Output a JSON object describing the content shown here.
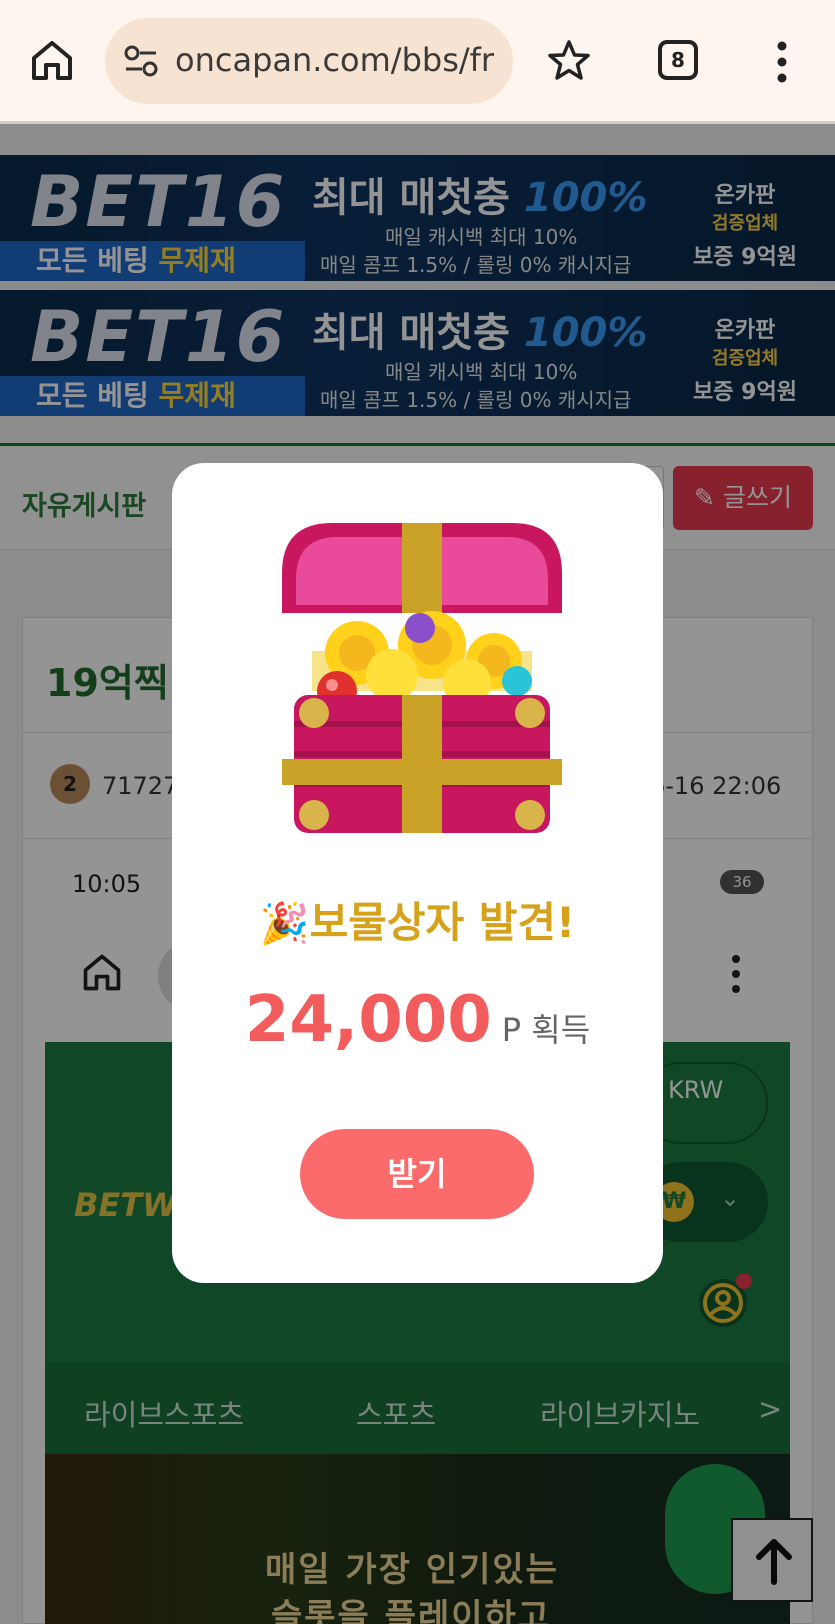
{
  "browser": {
    "url": "oncapan.com/bbs/fr",
    "tab_count": "8"
  },
  "banners": [
    {
      "brand": "BET16",
      "tagline_prefix": "모든 베팅 ",
      "tagline_highlight": "무제재",
      "headline_prefix": "최대 매첫충 ",
      "headline_highlight": "100%",
      "sub1": "매일 캐시백 최대 10%",
      "sub2": "매일 콤프 1.5% / 롤링 0% 캐시지급",
      "badge_line1": "온카판",
      "badge_line2": "검증업체",
      "badge_line3": "보증 9억원"
    },
    {
      "brand": "BET16",
      "tagline_prefix": "모든 베팅 ",
      "tagline_highlight": "무제재",
      "headline_prefix": "최대 매첫충 ",
      "headline_highlight": "100%",
      "sub1": "매일 캐시백 최대 10%",
      "sub2": "매일 콤프 1.5% / 롤링 0% 캐시지급",
      "badge_line1": "온카판",
      "badge_line2": "검증업체",
      "badge_line3": "보증 9억원"
    }
  ],
  "board": {
    "title": "자유게시판",
    "write_button": "글쓰기"
  },
  "post": {
    "title": "19억찍",
    "author_level": "2",
    "author": "71727",
    "date": "6-16 22:06"
  },
  "embedded": {
    "time": "10:05",
    "status_badge": "36",
    "currency": "KRW",
    "site_logo": "BETW",
    "coin_symbol": "₩",
    "nav": [
      "라이브스포츠",
      "스포츠",
      "라이브카지노",
      ">"
    ],
    "promo_line1": "매일 가장 인기있는",
    "promo_line2": "슬롯을 플레이하고"
  },
  "modal": {
    "emoji": "🎉",
    "title": "보물상자 발견!",
    "points": "24,000",
    "points_unit": "P 획득",
    "claim_button": "받기"
  },
  "colors": {
    "accent_red": "#f25c5c",
    "button_red": "#fc6b6b",
    "title_gold": "#d6a21c",
    "board_green": "#2b7a3a",
    "write_red": "#e8394e"
  }
}
